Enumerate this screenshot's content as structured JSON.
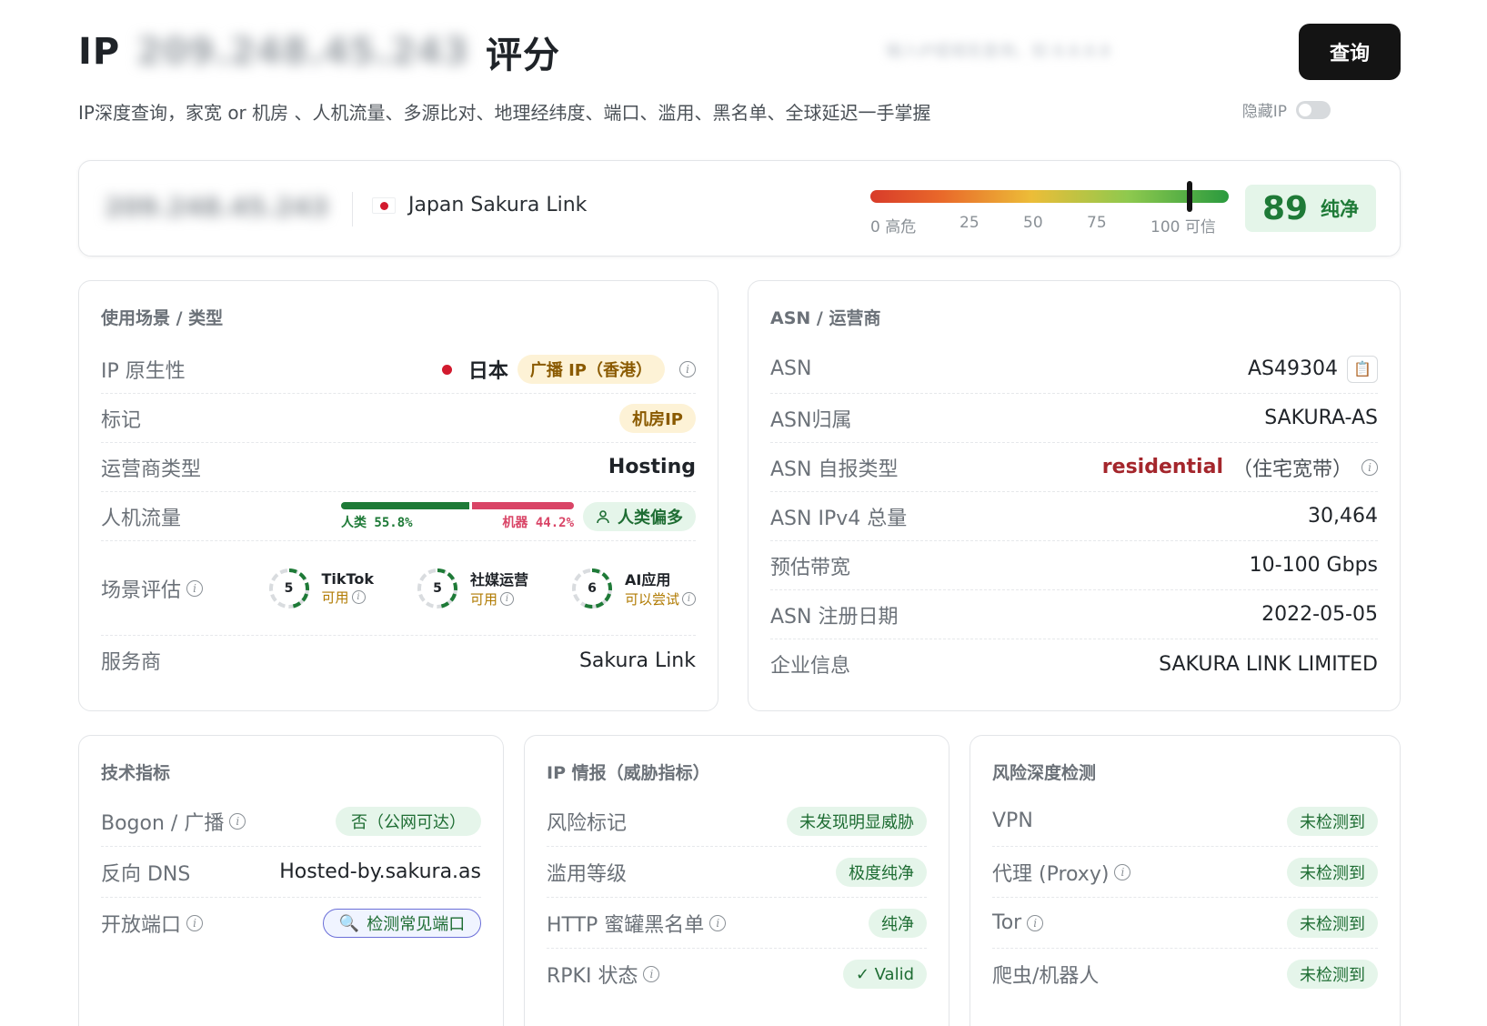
{
  "header": {
    "title_prefix": "IP",
    "title_ip": "209.248.45.243",
    "title_suffix": "评分",
    "search_placeholder": "输入IP或域名查询，如 8.8.8.8",
    "query_button": "查询",
    "subtitle": "IP深度查询，家宽 or 机房 、人机流量、多源比对、地理经纬度、端口、滥用、黑名单、全球延迟一手掌握",
    "hide_ip_label": "隐藏IP"
  },
  "score_card": {
    "ip": "209.248.45.243",
    "location": "Japan Sakura Link",
    "gauge_ticks": [
      "0 高危",
      "25",
      "50",
      "75",
      "100 可信"
    ],
    "score": 89,
    "score_value": "89",
    "score_label": "纯净"
  },
  "usage": {
    "title": "使用场景 / 类型",
    "native_label": "IP 原生性",
    "native_country": "日本",
    "native_badge": "广播 IP（香港）",
    "mark_label": "标记",
    "mark_badge": "机房IP",
    "isp_type_label": "运营商类型",
    "isp_type": "Hosting",
    "traffic_label": "人机流量",
    "traffic_human": 55.8,
    "traffic_bot": 44.2,
    "traffic_human_text": "人类 55.8%",
    "traffic_bot_text": "机器 44.2%",
    "traffic_badge": "人类偏多",
    "scene_label": "场景评估",
    "scenes": [
      {
        "score": "5",
        "name": "TikTok",
        "status": "可用"
      },
      {
        "score": "5",
        "name": "社媒运营",
        "status": "可用"
      },
      {
        "score": "6",
        "name": "AI应用",
        "status": "可以尝试"
      }
    ],
    "provider_label": "服务商",
    "provider": "Sakura Link"
  },
  "asn": {
    "title": "ASN / 运营商",
    "rows": [
      {
        "k": "ASN",
        "v": "AS49304"
      },
      {
        "k": "ASN归属",
        "v": "SAKURA-AS"
      },
      {
        "k": "ASN 自报类型",
        "v": "residential",
        "sub": "（住宅宽带）"
      },
      {
        "k": "ASN IPv4 总量",
        "v": "30,464"
      },
      {
        "k": "预估带宽",
        "v": "10-100 Gbps"
      },
      {
        "k": "ASN 注册日期",
        "v": "2022-05-05"
      },
      {
        "k": "企业信息",
        "v": "SAKURA LINK LIMITED"
      }
    ]
  },
  "tech": {
    "title": "技术指标",
    "bogon_label": "Bogon / 广播",
    "bogon_value": "否（公网可达）",
    "rdns_label": "反向 DNS",
    "rdns_value": "Hosted-by.sakura.as",
    "ports_label": "开放端口",
    "ports_button": "检测常见端口"
  },
  "intel": {
    "title": "IP 情报（威胁指标）",
    "rows": [
      {
        "k": "风险标记",
        "v": "未发现明显威胁"
      },
      {
        "k": "滥用等级",
        "v": "极度纯净"
      },
      {
        "k": "HTTP 蜜罐黑名单",
        "v": "纯净"
      },
      {
        "k": "RPKI 状态",
        "v": "✓ Valid"
      }
    ]
  },
  "risk": {
    "title": "风险深度检测",
    "rows": [
      {
        "k": "VPN",
        "v": "未检测到"
      },
      {
        "k": "代理 (Proxy)",
        "v": "未检测到"
      },
      {
        "k": "Tor",
        "v": "未检测到"
      },
      {
        "k": "爬虫/机器人",
        "v": "未检测到"
      }
    ]
  },
  "colors": {
    "accent_green": "#1e7a37",
    "danger_red": "#d94466",
    "button_dark": "#141414"
  }
}
